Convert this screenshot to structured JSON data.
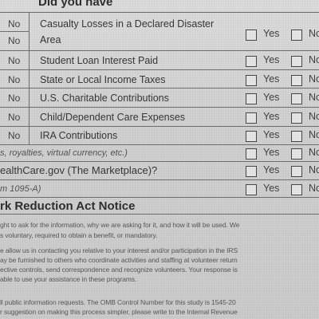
{
  "header": {
    "title": "Did you have"
  },
  "rows": [
    {
      "no": "No",
      "label_line1": "Casualty Losses in a Declared Disaster",
      "label_line2": "Area",
      "no_col": "No"
    },
    {
      "no": "No",
      "label": "Student Loan Interest Paid"
    },
    {
      "no": "No",
      "label": "State or Local Income Taxes"
    },
    {
      "no": "No",
      "label": "U.S. Charitable Contributions"
    },
    {
      "no": "No",
      "label": "Child/Dependent Care Expenses"
    },
    {
      "no": "No",
      "label": "IRA Contributions"
    }
  ],
  "yes_label": "Yes",
  "no_label": "No",
  "income_row": {
    "label": "s, royalties, virtual currency, etc.)"
  },
  "marketplace_row": {
    "label": "ealthCare.gov (The Marketplace)?"
  },
  "form_row": {
    "label": "m 1095-A)"
  },
  "privacy": {
    "title": "rk Reduction Act Notice",
    "lines": [
      "ght to ask for the information, why we are asking for it, and how it will be used. We",
      "s voluntary, required to obtain a benefit, or mandatory.",
      "e allow us in contacting you relative to your interest and/or participation in the IRS",
      "ay be furnished to others who coordinate activities and staffing at volunteer return",
      "ective controls, send correspondence and recognize volunteers. Your response is",
      "able to use your assistance in these programs.",
      "",
      "ll public information requests. The OMB Control Number for this study is 1545-20",
      "r suggestion on making this process simpler, please write to the Internal Revenue"
    ]
  }
}
